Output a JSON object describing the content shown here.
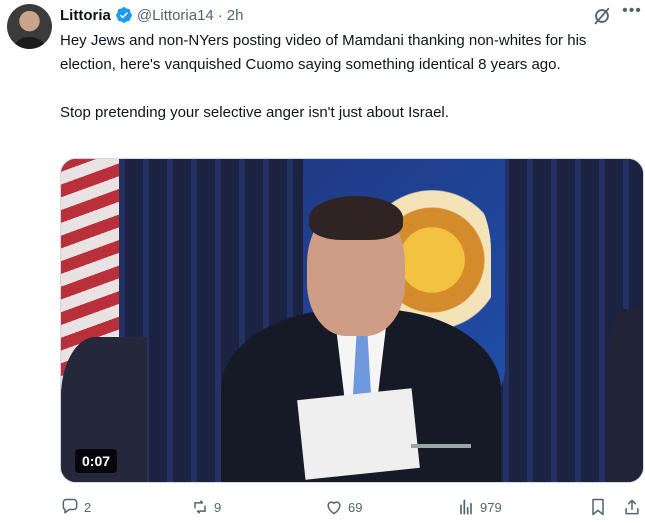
{
  "tweet": {
    "author_name": "Littoria",
    "handle": "@Littoria14",
    "separator": "·",
    "time": "2h",
    "paragraphs": [
      "Hey Jews and non-NYers posting video of Mamdani thanking non-whites for his election, here's vanquished Cuomo saying something identical 8 years ago.",
      "Stop pretending your selective anger isn't just about Israel."
    ],
    "video_duration": "0:07"
  },
  "actions": {
    "reply_count": "2",
    "repost_count": "9",
    "like_count": "69",
    "view_count": "979"
  },
  "icons": {
    "verified": "verified-badge-icon",
    "grok": "grok-icon",
    "more": "more-icon",
    "reply": "reply-icon",
    "repost": "repost-icon",
    "like": "heart-icon",
    "views": "views-icon",
    "bookmark": "bookmark-icon",
    "share": "share-icon"
  },
  "colors": {
    "accent": "#1d9bf0",
    "muted": "#536471",
    "text": "#0f1419"
  }
}
